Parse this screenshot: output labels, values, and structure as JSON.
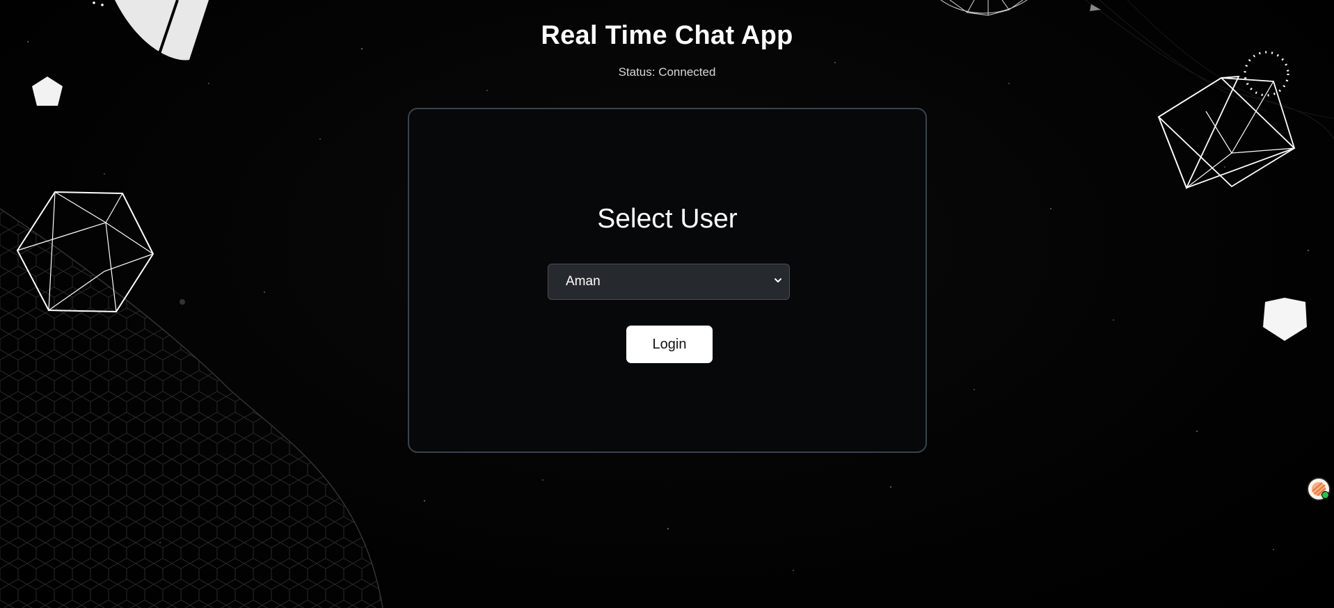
{
  "header": {
    "title": "Real Time Chat App",
    "status": "Status: Connected"
  },
  "login_card": {
    "heading": "Select User",
    "user_select": {
      "selected": "Aman"
    },
    "login_label": "Login"
  },
  "widget": {
    "icon": "assistant-avatar-icon",
    "online_color": "#27c24c"
  },
  "theme": {
    "background": "#030303",
    "card_border": "#3b4250",
    "select_bg": "#262a2e",
    "button_bg": "#ffffff"
  }
}
